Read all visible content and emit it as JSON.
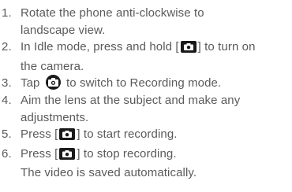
{
  "steps": [
    {
      "num": "1.",
      "lines": [
        "Rotate the phone anti-clockwise to",
        "landscape view."
      ]
    },
    {
      "num": "2.",
      "pre": "In Idle mode, press and hold [",
      "post": "] to turn on",
      "line2": "the camera."
    },
    {
      "num": "3.",
      "pre": "Tap ",
      "post": " to switch to Recording mode."
    },
    {
      "num": "4.",
      "lines": [
        "Aim the lens at the subject and make any",
        "adjustments."
      ]
    },
    {
      "num": "5.",
      "pre": "Press [",
      "post": "] to start recording."
    },
    {
      "num": "6.",
      "pre": "Press [",
      "post": "] to stop recording.",
      "note": "The video is saved automatically."
    }
  ]
}
